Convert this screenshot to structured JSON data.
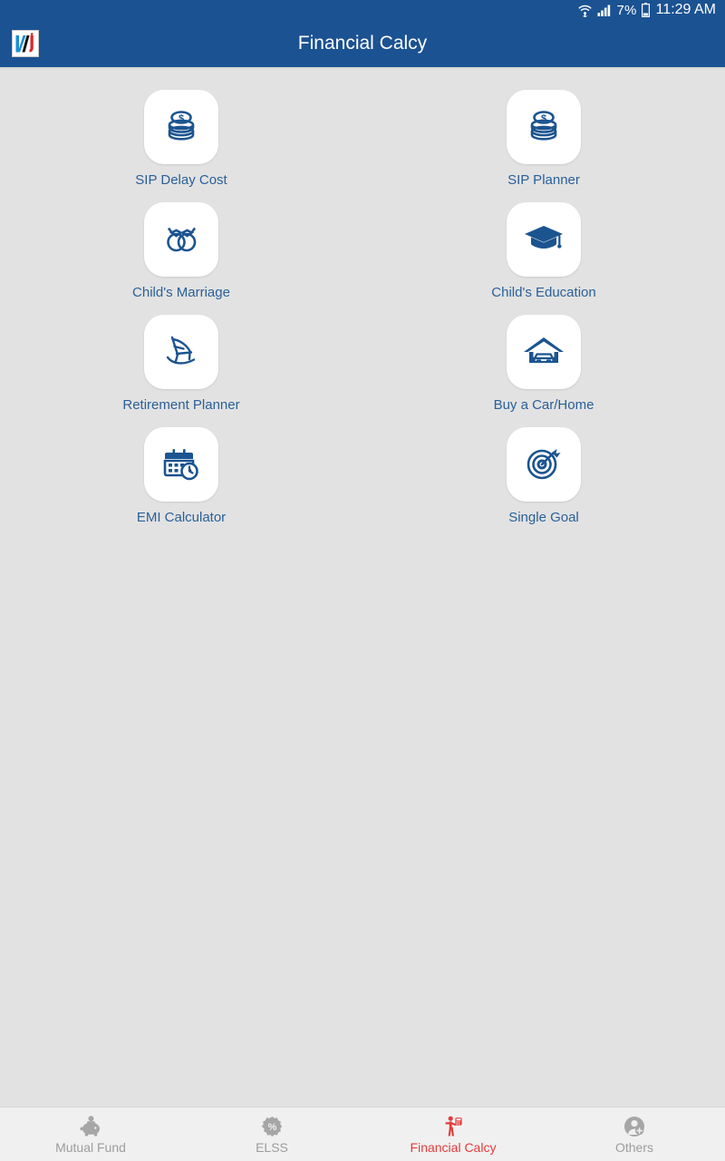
{
  "status_bar": {
    "wifi_icon": "wifi-icon",
    "signal_icon": "cellular-signal-icon",
    "battery_percent": "7%",
    "battery_icon": "battery-icon",
    "time": "11:29 AM"
  },
  "app_bar": {
    "logo_icon": "nj-logo-icon",
    "logo_letters": "NJ",
    "title": "Financial Calcy",
    "background_color": "#1b5292",
    "title_color": "#ffffff"
  },
  "theme": {
    "page_background": "#e2e2e2",
    "tile_background": "#ffffff",
    "tile_label_color": "#2a6099",
    "icon_color": "#1c5490",
    "nav_inactive_color": "#9d9d9d",
    "nav_active_color": "#e23b3b"
  },
  "calculators": [
    {
      "label": "SIP Delay Cost",
      "icon": "coin-stack-icon"
    },
    {
      "label": "SIP Planner",
      "icon": "coin-stack-icon"
    },
    {
      "label": "Child's Marriage",
      "icon": "wedding-rings-icon"
    },
    {
      "label": "Child's Education",
      "icon": "graduation-cap-icon"
    },
    {
      "label": "Retirement Planner",
      "icon": "rocking-chair-icon"
    },
    {
      "label": "Buy a Car/Home",
      "icon": "house-garage-car-icon"
    },
    {
      "label": "EMI Calculator",
      "icon": "calendar-clock-icon"
    },
    {
      "label": "Single Goal",
      "icon": "target-dart-icon"
    }
  ],
  "bottom_nav": [
    {
      "label": "Mutual Fund",
      "icon": "piggy-bank-icon",
      "active": false
    },
    {
      "label": "ELSS",
      "icon": "percent-badge-icon",
      "active": false
    },
    {
      "label": "Financial Calcy",
      "icon": "person-calculator-icon",
      "active": true
    },
    {
      "label": "Others",
      "icon": "user-add-icon",
      "active": false
    }
  ]
}
